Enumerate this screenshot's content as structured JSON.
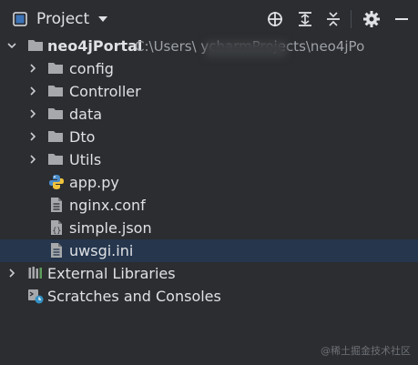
{
  "header": {
    "title": "Project",
    "icons": [
      "project-view-icon",
      "chevron-down-icon",
      "locate-icon",
      "expand-all-icon",
      "collapse-all-icon",
      "gear-icon",
      "minimize-icon"
    ]
  },
  "tree": {
    "root": {
      "name": "neo4jPortal",
      "path": "C:\\Users\\        ycharmProjects\\neo4jPo"
    },
    "folders": [
      {
        "label": "config"
      },
      {
        "label": "Controller"
      },
      {
        "label": "data"
      },
      {
        "label": "Dto"
      },
      {
        "label": "Utils"
      }
    ],
    "files": [
      {
        "label": "app.py",
        "icon": "python-file-icon"
      },
      {
        "label": "nginx.conf",
        "icon": "text-file-icon"
      },
      {
        "label": "simple.json",
        "icon": "json-file-icon"
      },
      {
        "label": "uwsgi.ini",
        "icon": "text-file-icon",
        "selected": true
      }
    ],
    "external_libraries": "External Libraries",
    "scratches": "Scratches and Consoles"
  },
  "watermark": "@稀土掘金技术社区",
  "colors": {
    "background": "#2b2d30",
    "selection": "#25364d",
    "folder": "#a6a8ab",
    "text": "#dfe1e5",
    "path_text": "#9ea2a8"
  }
}
